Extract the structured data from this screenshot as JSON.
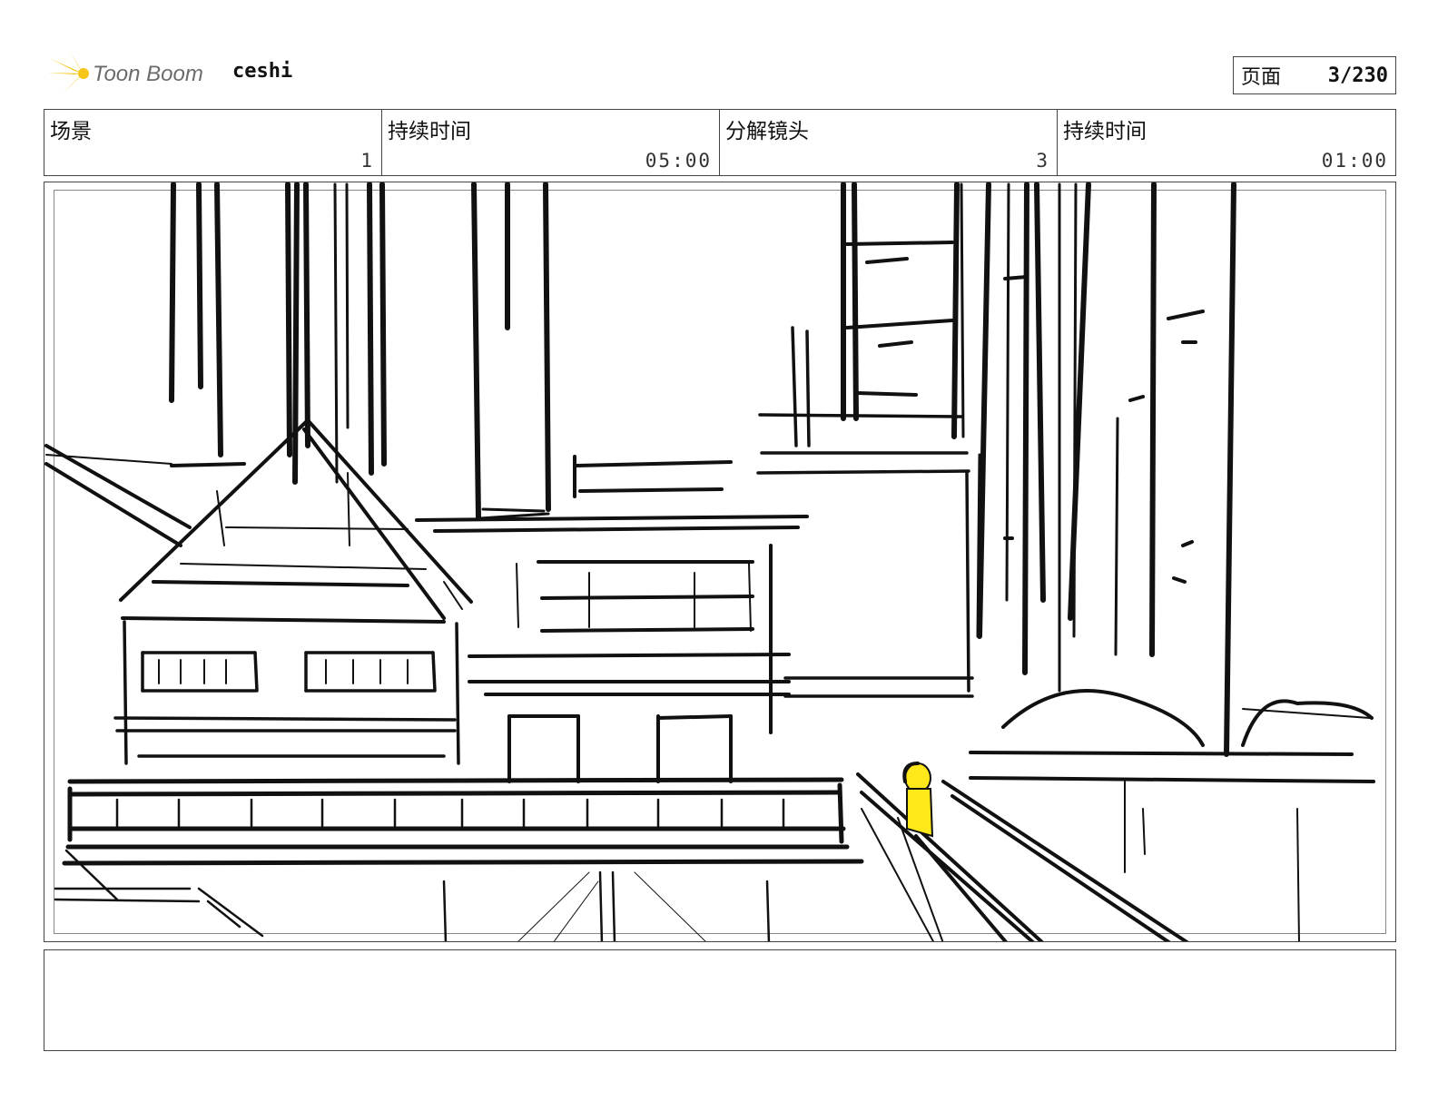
{
  "header": {
    "brand": "Toon Boom",
    "project_name": "ceshi",
    "page_label": "页面",
    "page_value": "3/230"
  },
  "info": {
    "scene_label": "场景",
    "scene_value": "1",
    "duration_label": "持续时间",
    "duration_value": "05:00",
    "panel_label": "分解镜头",
    "panel_value": "3",
    "panel_duration_label": "持续时间",
    "panel_duration_value": "01:00"
  },
  "colors": {
    "logo_yellow": "#f5c518",
    "figure_yellow": "#ffe81a",
    "logo_text": "#6b6b6b"
  },
  "icons": {
    "logo": "toon-boom-burst-icon"
  },
  "notes": {
    "text": ""
  }
}
